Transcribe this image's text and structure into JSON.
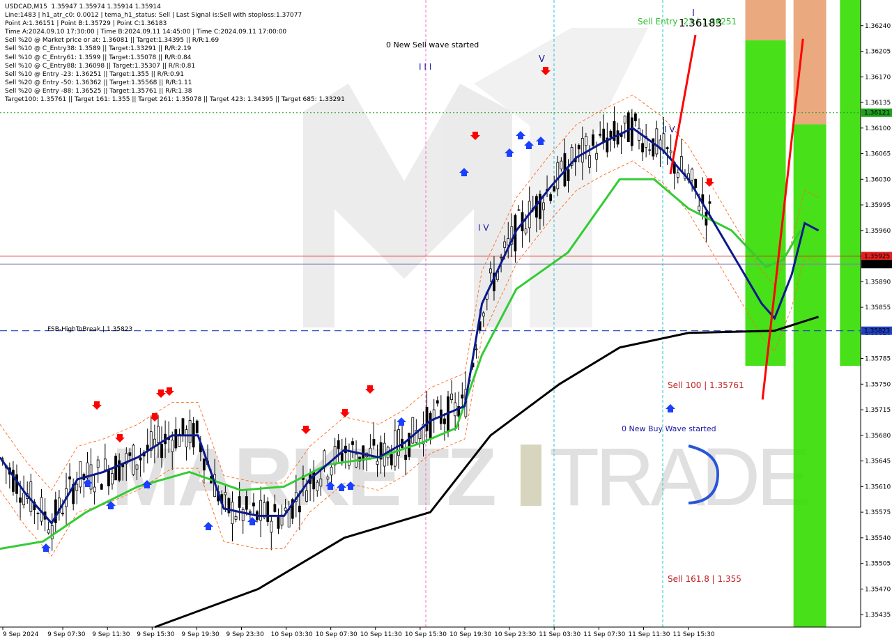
{
  "header": {
    "info_lines": [
      "USDCAD,M15  1.35947 1.35974 1.35914 1.35914",
      "Line:1483 | h1_atr_c0: 0.0012 | tema_h1_status: Sell | Last Signal is:Sell with stoploss:1.37077",
      "Point A:1.36151 | Point B:1.35729 | Point C:1.36183",
      "Time A:2024.09.10 17:30:00 | Time B:2024.09.11 14:45:00 | Time C:2024.09.11 17:00:00",
      "Sell %20 @ Market price or at: 1.36081 || Target:1.34395 || R/R:1.69",
      "Sell %10 @ C_Entry38: 1.3589 || Target:1.33291 || R/R:2.19",
      "Sell %10 @ C_Entry61: 1.3599 || Target:1.35078 || R/R:0.84",
      "Sell %10 @ C_Entry88: 1.36098 || Target:1.35307 || R/R:0.81",
      "Sell %10 @ Entry -23: 1.36251 || Target:1.355 || R/R:0.91",
      "Sell %20 @ Entry -50: 1.36362 || Target:1.35568 || R/R:1.11",
      "Sell %20 @ Entry -88: 1.36525 || Target:1.35761 || R/R:1.38",
      "Target100: 1.35761 || Target 161: 1.355 || Target 261: 1.35078 || Target 423: 1.34395 || Target 685: 1.33291"
    ]
  },
  "annotations": {
    "sell_wave": "0 New Sell wave started",
    "buy_wave": "0 New Buy Wave started",
    "wave_iii": "I I I",
    "wave_iv": "I V",
    "wave_v": "V",
    "wave_iv2": "I V",
    "wave_i": "I",
    "sell_entry": "Sell Entry -23 | 1.36251",
    "point_c": "1.36183",
    "sell_100": "Sell 100 | 1.35761",
    "sell_161": "Sell 161.8 | 1.355",
    "fsb": "FSB-HighToBreak | 1.35823"
  },
  "watermark": {
    "text_left": "MARKETZ",
    "text_i": "I",
    "text_right": "TRADE"
  },
  "price_axis": {
    "ticks": [
      "1.36240",
      "1.36205",
      "1.36170",
      "1.36135",
      "1.36100",
      "1.36065",
      "1.36030",
      "1.35995",
      "1.35960",
      "1.35925",
      "1.35890",
      "1.35855",
      "1.35820",
      "1.35785",
      "1.35750",
      "1.35715",
      "1.35680",
      "1.35645",
      "1.35610",
      "1.35575",
      "1.35540",
      "1.35505",
      "1.35470",
      "1.35435"
    ],
    "badges": [
      {
        "label": "1.36121",
        "value": 1.36121,
        "color": "#1f9e1f"
      },
      {
        "label": "1.35925",
        "value": 1.35925,
        "color": "#e02020"
      },
      {
        "label": "1.35914",
        "value": 1.35914,
        "color": "#000000"
      },
      {
        "label": "1.35823",
        "value": 1.35823,
        "color": "#1f3fbf"
      }
    ]
  },
  "time_axis": {
    "labels": [
      "9 Sep 2024",
      "9 Sep 07:30",
      "9 Sep 11:30",
      "9 Sep 15:30",
      "9 Sep 19:30",
      "9 Sep 23:30",
      "10 Sep 03:30",
      "10 Sep 07:30",
      "10 Sep 11:30",
      "10 Sep 15:30",
      "10 Sep 19:30",
      "10 Sep 23:30",
      "11 Sep 03:30",
      "11 Sep 07:30",
      "11 Sep 11:30",
      "11 Sep 15:30"
    ]
  },
  "colors": {
    "up_candle": "#000000",
    "down_candle": "#000000",
    "tema_blue": "#0a1a8c",
    "ma_green": "#33cc33",
    "ma_black": "#000000",
    "zone_green": "#33dd00",
    "zone_orange": "#e8a070",
    "sell_red": "#ff0000",
    "buy_blue": "#1a3fff"
  },
  "chart_data": {
    "type": "candlestick",
    "symbol": "USDCAD",
    "timeframe": "M15",
    "last_ohlc": {
      "open": 1.35947,
      "high": 1.35974,
      "low": 1.35914,
      "close": 1.35914
    },
    "ylim": [
      1.35418,
      1.36275
    ],
    "levels": [
      {
        "name": "FSB-HighToBreak",
        "value": 1.35823,
        "style": "dashed",
        "color": "#1f3fbf"
      },
      {
        "name": "green dotted",
        "value": 1.36121,
        "style": "dotted",
        "color": "#1f9e1f"
      },
      {
        "name": "red",
        "value": 1.35925,
        "style": "solid",
        "color": "#e02020"
      },
      {
        "name": "current",
        "value": 1.35914,
        "style": "solid",
        "color": "#7a7aa0"
      }
    ],
    "trend_line": [
      {
        "t": 0.886,
        "y": 1.35729
      },
      {
        "t": 0.933,
        "y": 1.36222
      }
    ],
    "blue_anchor": [
      {
        "t": 0.896,
        "y": 1.35729
      },
      {
        "t": 0.903,
        "y": 1.3584
      }
    ],
    "ma_black": [
      [
        0.18,
        1.35418
      ],
      [
        0.3,
        1.3547
      ],
      [
        0.4,
        1.3554
      ],
      [
        0.5,
        1.35575
      ],
      [
        0.57,
        1.3568
      ],
      [
        0.65,
        1.3575
      ],
      [
        0.72,
        1.358
      ],
      [
        0.8,
        1.3582
      ],
      [
        0.9,
        1.35823
      ],
      [
        0.951,
        1.35842
      ]
    ],
    "ma_green": [
      [
        0.0,
        1.35525
      ],
      [
        0.05,
        1.35535
      ],
      [
        0.1,
        1.35575
      ],
      [
        0.16,
        1.3561
      ],
      [
        0.22,
        1.3563
      ],
      [
        0.28,
        1.35605
      ],
      [
        0.33,
        1.3561
      ],
      [
        0.38,
        1.3564
      ],
      [
        0.44,
        1.3565
      ],
      [
        0.49,
        1.3567
      ],
      [
        0.53,
        1.3569
      ],
      [
        0.56,
        1.3579
      ],
      [
        0.6,
        1.3588
      ],
      [
        0.66,
        1.3593
      ],
      [
        0.72,
        1.3603
      ],
      [
        0.76,
        1.3603
      ],
      [
        0.8,
        1.3599
      ],
      [
        0.85,
        1.3596
      ],
      [
        0.89,
        1.3591
      ],
      [
        0.91,
        1.3592
      ],
      [
        0.93,
        1.3596
      ]
    ],
    "ma_navy": [
      [
        0.0,
        1.3565
      ],
      [
        0.03,
        1.356
      ],
      [
        0.06,
        1.3556
      ],
      [
        0.09,
        1.3562
      ],
      [
        0.12,
        1.3563
      ],
      [
        0.16,
        1.3565
      ],
      [
        0.2,
        1.3568
      ],
      [
        0.23,
        1.3568
      ],
      [
        0.26,
        1.3558
      ],
      [
        0.3,
        1.3557
      ],
      [
        0.33,
        1.3557
      ],
      [
        0.36,
        1.3562
      ],
      [
        0.4,
        1.3566
      ],
      [
        0.44,
        1.3565
      ],
      [
        0.47,
        1.3567
      ],
      [
        0.5,
        1.357
      ],
      [
        0.54,
        1.3572
      ],
      [
        0.56,
        1.3586
      ],
      [
        0.6,
        1.3596
      ],
      [
        0.64,
        1.3602
      ],
      [
        0.67,
        1.3606
      ],
      [
        0.7,
        1.3608
      ],
      [
        0.735,
        1.361
      ],
      [
        0.77,
        1.3607
      ],
      [
        0.8,
        1.3603
      ],
      [
        0.83,
        1.3597
      ],
      [
        0.86,
        1.3591
      ],
      [
        0.885,
        1.3586
      ],
      [
        0.9,
        1.3584
      ],
      [
        0.92,
        1.359
      ],
      [
        0.935,
        1.3597
      ],
      [
        0.951,
        1.3596
      ]
    ],
    "band_zones": [
      {
        "t0": 0.866,
        "t1": 0.913,
        "y0": 1.36275,
        "y1": 1.3622,
        "color": "orange"
      },
      {
        "t0": 0.866,
        "t1": 0.913,
        "y0": 1.3622,
        "y1": 1.35775,
        "color": "green"
      },
      {
        "t0": 0.922,
        "t1": 0.96,
        "y0": 1.36275,
        "y1": 1.36105,
        "color": "orange"
      },
      {
        "t0": 0.922,
        "t1": 0.96,
        "y0": 1.36105,
        "y1": 1.35418,
        "color": "green"
      },
      {
        "t0": 0.976,
        "t1": 1.013,
        "y0": 1.36275,
        "y1": 1.35775,
        "color": "green"
      }
    ]
  }
}
